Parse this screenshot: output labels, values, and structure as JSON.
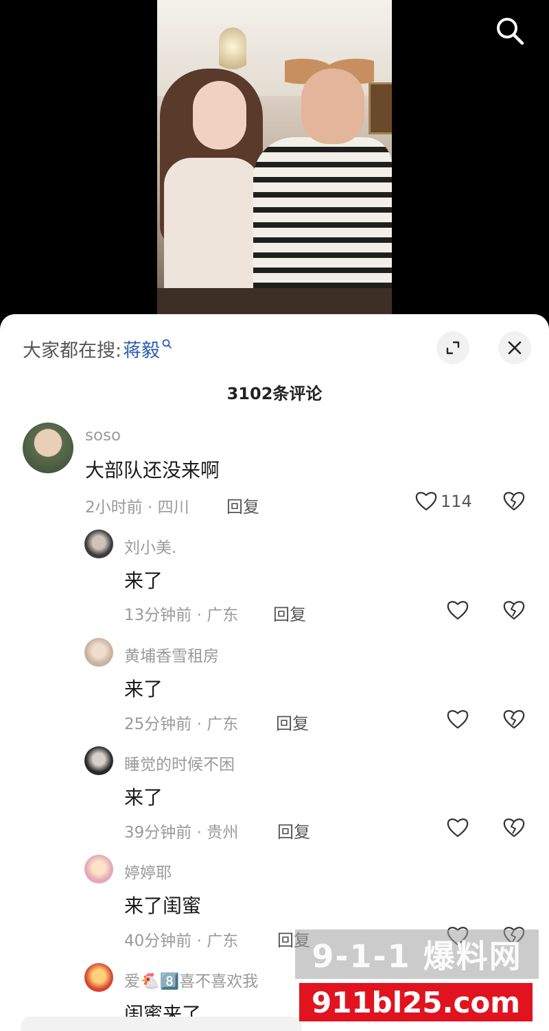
{
  "search_bar": {
    "prefix": "大家都在搜:",
    "term": "蒋毅"
  },
  "comment_count": "3102条评论",
  "comments": [
    {
      "username": "soso",
      "text": "大部队还没来啊",
      "meta": "2小时前 · 四川",
      "reply": "回复",
      "likes": "114"
    },
    {
      "username": "刘小美.",
      "text": "来了",
      "meta": "13分钟前 · 广东",
      "reply": "回复"
    },
    {
      "username": "黄埔香雪租房",
      "text": "来了",
      "meta": "25分钟前 · 广东",
      "reply": "回复"
    },
    {
      "username": "睡觉的时候不困",
      "text": "来了",
      "meta": "39分钟前 · 贵州",
      "reply": "回复"
    },
    {
      "username": "婷婷耶",
      "text": "来了闺蜜",
      "meta": "40分钟前 · 广东",
      "reply": "回复"
    },
    {
      "username": "爱🐔8️⃣喜不喜欢我",
      "text": "闺蜜来了"
    }
  ],
  "watermark": {
    "top": "9-1-1 爆料网",
    "bottom": "911bl25.com"
  }
}
